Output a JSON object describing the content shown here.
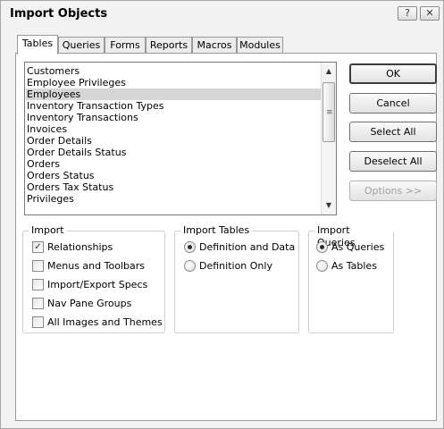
{
  "window": {
    "title": "Import Objects",
    "help_glyph": "?",
    "close_glyph": "✕"
  },
  "tabs": [
    "Tables",
    "Queries",
    "Forms",
    "Reports",
    "Macros",
    "Modules"
  ],
  "active_tab": "Tables",
  "objects": {
    "items": [
      "Customers",
      "Employee Privileges",
      "Employees",
      "Inventory Transaction Types",
      "Inventory Transactions",
      "Invoices",
      "Order Details",
      "Order Details Status",
      "Orders",
      "Orders Status",
      "Orders Tax Status",
      "Privileges"
    ],
    "selected": "Employees"
  },
  "buttons": {
    "ok": "OK",
    "cancel": "Cancel",
    "select_all": "Select All",
    "deselect_all": "Deselect All",
    "options": "Options >>"
  },
  "import_group": {
    "legend": "Import",
    "relationships": "Relationships",
    "relationships_checked": true,
    "menus_toolbars": "Menus and Toolbars",
    "import_export_specs": "Import/Export Specs",
    "nav_pane_groups": "Nav Pane Groups",
    "all_images_themes": "All Images and Themes"
  },
  "import_tables_group": {
    "legend": "Import Tables",
    "definition_and_data": "Definition and Data",
    "definition_only": "Definition Only",
    "selected": "Definition and Data"
  },
  "import_queries_group": {
    "legend": "Import Queries",
    "as_queries": "As Queries",
    "as_tables": "As Tables",
    "selected": "As Queries"
  },
  "icons": {
    "check": "✓",
    "scroll_up": "▲",
    "scroll_down": "▼",
    "grip": "≡"
  }
}
